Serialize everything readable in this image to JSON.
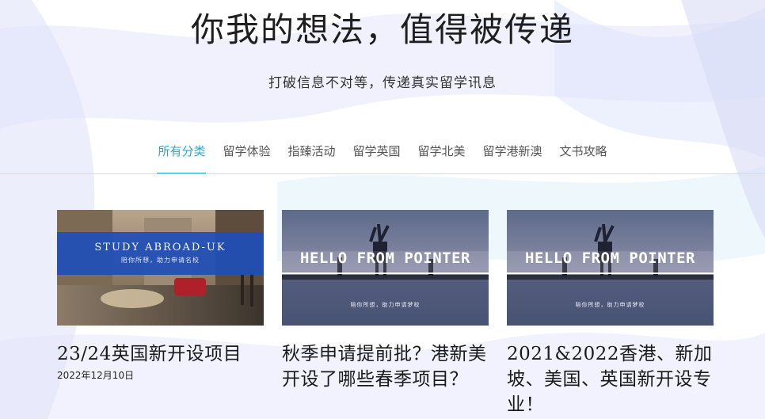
{
  "hero": {
    "title": "你我的想法，值得被传递",
    "subtitle": "打破信息不对等，传递真实留学讯息"
  },
  "nav": {
    "items": [
      {
        "label": "所有分类",
        "active": true
      },
      {
        "label": "留学体验",
        "active": false
      },
      {
        "label": "指臻活动",
        "active": false
      },
      {
        "label": "留学英国",
        "active": false
      },
      {
        "label": "留学北美",
        "active": false
      },
      {
        "label": "留学港新澳",
        "active": false
      },
      {
        "label": "文书攻略",
        "active": false
      }
    ]
  },
  "posts": [
    {
      "title": "23/24英国新开设项目",
      "date": "2022年12月10日",
      "thumb_heading": "STUDY ABROAD-UK",
      "thumb_caption": "陪你所想，助力申请名校"
    },
    {
      "title": "秋季申请提前批？港新美开设了哪些春季项目？",
      "date": "",
      "thumb_heading": "HELLO FROM POINTER",
      "thumb_caption": "陪你所想，助力申请梦校"
    },
    {
      "title": "2021&2022香港、新加坡、美国、英国新开设专业！",
      "date": "",
      "thumb_heading": "HELLO FROM POINTER",
      "thumb_caption": "陪你所想，助力申请梦校"
    }
  ],
  "colors": {
    "accent": "#29a9c9",
    "uk_banner": "#1f4fb8"
  }
}
